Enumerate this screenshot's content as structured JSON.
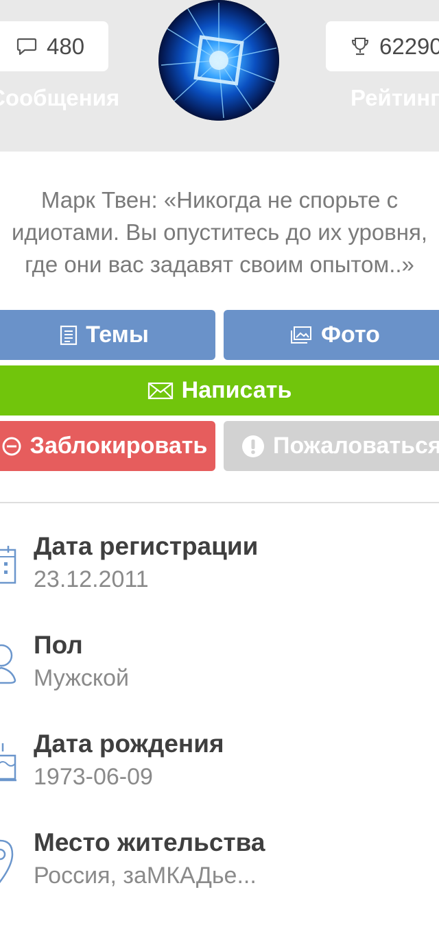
{
  "stats": {
    "messages": {
      "count": "480",
      "label": "Сообщения",
      "icon": "comment-icon"
    },
    "rating": {
      "count": "62290",
      "label": "Рейтинг",
      "icon": "trophy-icon"
    }
  },
  "avatar": {
    "icon": "user-avatar"
  },
  "quote": {
    "lines": [
      "Марк Твен:  «Никогда не спорьте с",
      "идиотами. Вы опуститесь до их уровня,",
      "где они вас задавят своим опытом..»"
    ]
  },
  "buttons": {
    "topics": "Темы",
    "photo": "Фото",
    "write": "Написать",
    "block": "Заблокировать",
    "report": "Пожаловаться"
  },
  "colors": {
    "blue": "#6a92c9",
    "green": "#71c50c",
    "red": "#e65d5d",
    "grey": "#d2d2d2",
    "icon_blue": "#6b96cc"
  },
  "info": {
    "registration": {
      "label": "Дата регистрации",
      "value": "23.12.2011",
      "icon": "calendar-icon"
    },
    "gender": {
      "label": "Пол",
      "value": "Мужской",
      "icon": "user-icon"
    },
    "birthday": {
      "label": "Дата рождения",
      "value": "1973-06-09",
      "icon": "cake-icon"
    },
    "location": {
      "label": "Место жительства",
      "value": "Россия, заМКАДье...",
      "icon": "map-pin-icon"
    }
  }
}
